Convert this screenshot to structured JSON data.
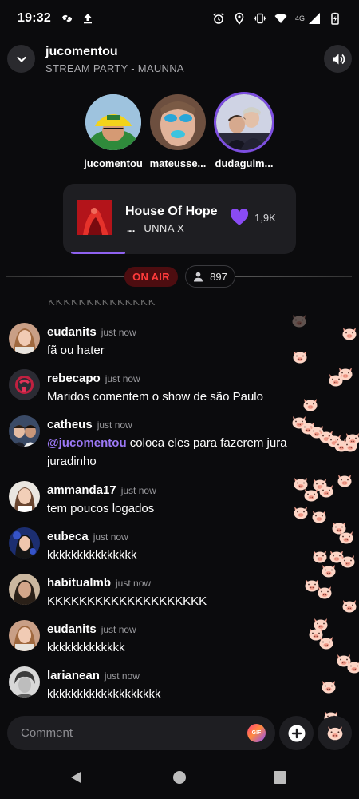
{
  "status_bar": {
    "time": "19:32",
    "left_icons": [
      "sync-icon",
      "upload-icon"
    ],
    "right_icons": [
      "alarm-icon",
      "location-icon",
      "vibrate-icon",
      "wifi-icon",
      "signal-icon",
      "battery-icon"
    ],
    "network": "4G"
  },
  "header": {
    "title": "jucomentou",
    "subtitle": "STREAM PARTY - MAUNNA"
  },
  "participants": [
    {
      "name": "jucomentou"
    },
    {
      "name": "mateusse..."
    },
    {
      "name": "dudaguim..."
    }
  ],
  "now_playing": {
    "title": "House Of Hope",
    "artist": "UNNA X",
    "eq": "....",
    "likes": "1,9K",
    "progress": 0.25,
    "accent": "#8f62f0"
  },
  "live": {
    "on_air_label": "ON AIR",
    "viewers": "897"
  },
  "chat": {
    "cutoff_text": "KKKKKKKKKKKKKK",
    "messages": [
      {
        "user": "eudanits",
        "time": "just now",
        "text": "fã ou hater"
      },
      {
        "user": "rebecapo",
        "time": "just now",
        "text": "Maridos comentem o show de são Paulo"
      },
      {
        "user": "catheus",
        "time": "just now",
        "mention": "@jucomentou",
        "text": " coloca eles para fazerem jura juradinho"
      },
      {
        "user": "ammanda17",
        "time": "just now",
        "text": "tem poucos logados"
      },
      {
        "user": "eubeca",
        "time": "just now",
        "text": "kkkkkkkkkkkkkkk"
      },
      {
        "user": "habitualmb",
        "time": "just now",
        "text": "KKKKKKKKKKKKKKKKKKKK"
      },
      {
        "user": "eudanits",
        "time": "just now",
        "text": "kkkkkkkkkkkkk"
      },
      {
        "user": "larianean",
        "time": "just now",
        "text": "kkkkkkkkkkkkkkkkkkk"
      }
    ]
  },
  "composer": {
    "placeholder": "Comment",
    "gif_label": "GIF"
  },
  "colors": {
    "background": "#0b0b0d",
    "on_air": "#ff3b3b",
    "mention": "#9b78f5",
    "heart": "#8a4bf4"
  }
}
